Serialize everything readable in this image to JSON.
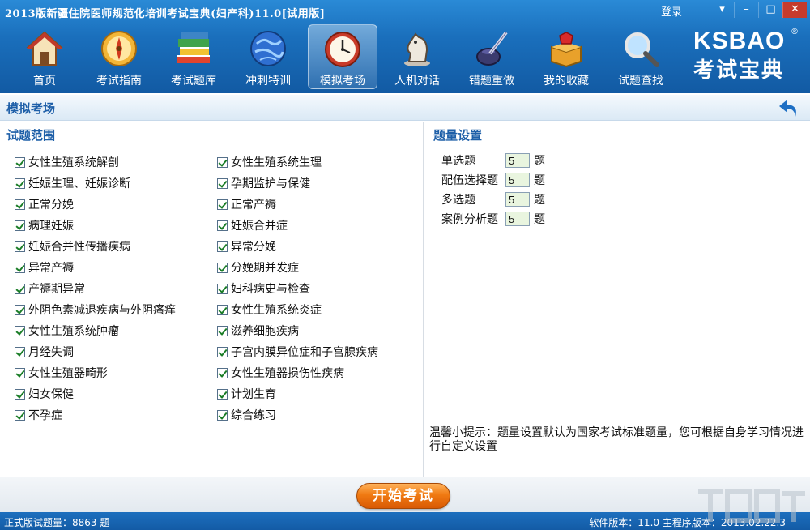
{
  "titlebar": {
    "title": "2013版新疆住院医师规范化培训考试宝典(妇产科)11.0[试用版]",
    "login": "登录",
    "buttons": [
      "▾",
      "–",
      "□",
      "✕"
    ]
  },
  "nav": {
    "items": [
      {
        "label": "首页",
        "icon": "home-icon"
      },
      {
        "label": "考试指南",
        "icon": "compass-icon"
      },
      {
        "label": "考试题库",
        "icon": "books-icon"
      },
      {
        "label": "冲刺特训",
        "icon": "globe-icon"
      },
      {
        "label": "模拟考场",
        "icon": "clock-icon",
        "active": true
      },
      {
        "label": "人机对话",
        "icon": "chess-knight-icon"
      },
      {
        "label": "错题重做",
        "icon": "ink-pen-icon"
      },
      {
        "label": "我的收藏",
        "icon": "treasure-box-icon"
      },
      {
        "label": "试题查找",
        "icon": "magnifier-icon"
      }
    ]
  },
  "logo": {
    "en": "KSBAO",
    "cn": "考试宝典",
    "mark": "®"
  },
  "section": {
    "title": "模拟考场"
  },
  "scope": {
    "heading": "试题范围",
    "topics": [
      "女性生殖系统解剖",
      "女性生殖系统生理",
      "妊娠生理、妊娠诊断",
      "孕期监护与保健",
      "正常分娩",
      "正常产褥",
      "病理妊娠",
      "妊娠合并症",
      "妊娠合并性传播疾病",
      "异常分娩",
      "异常产褥",
      "分娩期并发症",
      "产褥期异常",
      "妇科病史与检查",
      "外阴色素减退疾病与外阴瘙痒",
      "女性生殖系统炎症",
      "女性生殖系统肿瘤",
      "滋养细胞疾病",
      "月经失调",
      "子宫内膜异位症和子宫腺疾病",
      "女性生殖器畸形",
      "女性生殖器损伤性疾病",
      "妇女保健",
      "计划生育",
      "不孕症",
      "综合练习"
    ]
  },
  "quantity": {
    "heading": "题量设置",
    "unit": "题",
    "rows": [
      {
        "label": "单选题",
        "value": "5"
      },
      {
        "label": "配伍选择题",
        "value": "5"
      },
      {
        "label": "多选题",
        "value": "5"
      },
      {
        "label": "案例分析题",
        "value": "5"
      }
    ],
    "tip": "温馨小提示：题量设置默认为国家考试标准题量，您可根据自身学习情况进行自定义设置"
  },
  "actions": {
    "start": "开始考试"
  },
  "status": {
    "left": "正式版试题量：8863 题",
    "right": "软件版本：11.0 主程序版本：2013.02.22.3"
  },
  "colors": {
    "header_blue": "#1a6fbc",
    "accent_orange": "#f07a12",
    "heading_blue": "#1e5fa8"
  }
}
